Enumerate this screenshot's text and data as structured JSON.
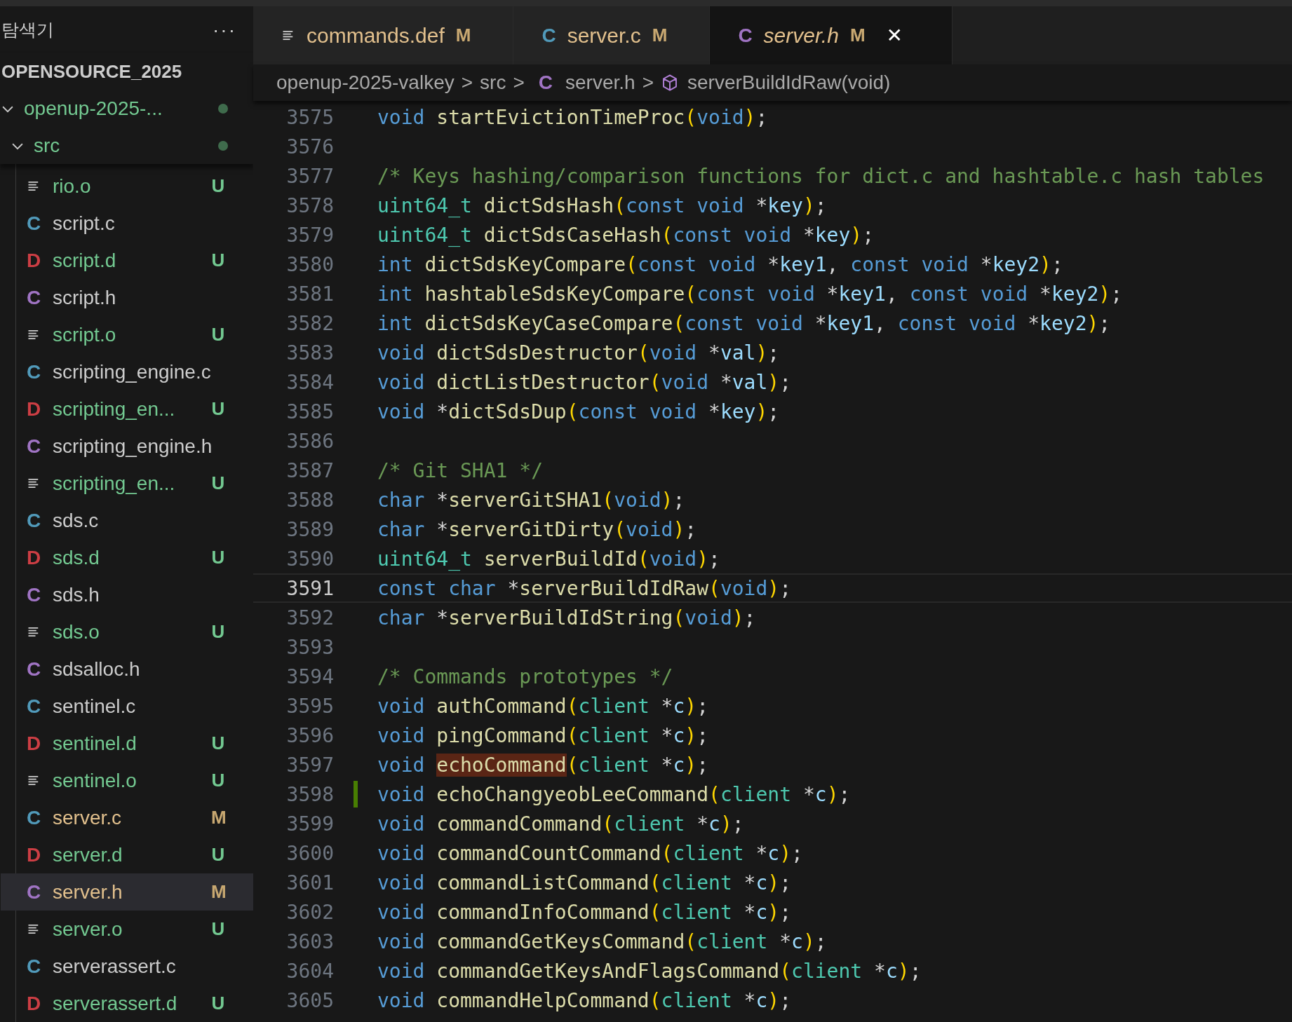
{
  "sidebar": {
    "title": "탐색기",
    "more": "···",
    "workspace": "OPENSOURCE_2025",
    "folders": [
      {
        "name": "openup-2025-...",
        "expanded": true
      },
      {
        "name": "src",
        "expanded": true
      }
    ],
    "files": [
      {
        "kind": "o",
        "name": "rio.o",
        "untracked": true,
        "status": "U",
        "selected": false
      },
      {
        "kind": "c",
        "badge": "C",
        "name": "script.c",
        "untracked": false,
        "modified": false,
        "selected": false
      },
      {
        "kind": "d",
        "badge": "D",
        "name": "script.d",
        "untracked": true,
        "status": "U",
        "selected": false
      },
      {
        "kind": "h",
        "badge": "C",
        "name": "script.h",
        "untracked": false,
        "modified": false,
        "selected": false
      },
      {
        "kind": "o",
        "name": "script.o",
        "untracked": true,
        "status": "U",
        "selected": false
      },
      {
        "kind": "c",
        "badge": "C",
        "name": "scripting_engine.c",
        "untracked": false,
        "modified": false,
        "selected": false
      },
      {
        "kind": "d",
        "badge": "D",
        "name": "scripting_en...",
        "untracked": true,
        "status": "U",
        "selected": false
      },
      {
        "kind": "h",
        "badge": "C",
        "name": "scripting_engine.h",
        "untracked": false,
        "modified": false,
        "selected": false
      },
      {
        "kind": "o",
        "name": "scripting_en...",
        "untracked": true,
        "status": "U",
        "selected": false
      },
      {
        "kind": "c",
        "badge": "C",
        "name": "sds.c",
        "untracked": false,
        "modified": false,
        "selected": false
      },
      {
        "kind": "d",
        "badge": "D",
        "name": "sds.d",
        "untracked": true,
        "status": "U",
        "selected": false
      },
      {
        "kind": "h",
        "badge": "C",
        "name": "sds.h",
        "untracked": false,
        "modified": false,
        "selected": false
      },
      {
        "kind": "o",
        "name": "sds.o",
        "untracked": true,
        "status": "U",
        "selected": false
      },
      {
        "kind": "h",
        "badge": "C",
        "name": "sdsalloc.h",
        "untracked": false,
        "modified": false,
        "selected": false
      },
      {
        "kind": "c",
        "badge": "C",
        "name": "sentinel.c",
        "untracked": false,
        "modified": false,
        "selected": false
      },
      {
        "kind": "d",
        "badge": "D",
        "name": "sentinel.d",
        "untracked": true,
        "status": "U",
        "selected": false
      },
      {
        "kind": "o",
        "name": "sentinel.o",
        "untracked": true,
        "status": "U",
        "selected": false
      },
      {
        "kind": "c",
        "badge": "C",
        "name": "server.c",
        "untracked": false,
        "modified": true,
        "status": "M",
        "selected": false
      },
      {
        "kind": "d",
        "badge": "D",
        "name": "server.d",
        "untracked": true,
        "status": "U",
        "selected": false
      },
      {
        "kind": "h",
        "badge": "C",
        "name": "server.h",
        "untracked": false,
        "modified": true,
        "status": "M",
        "selected": true
      },
      {
        "kind": "o",
        "name": "server.o",
        "untracked": true,
        "status": "U",
        "selected": false
      },
      {
        "kind": "c",
        "badge": "C",
        "name": "serverassert.c",
        "untracked": false,
        "modified": false,
        "selected": false
      },
      {
        "kind": "d",
        "badge": "D",
        "name": "serverassert.d",
        "untracked": true,
        "status": "U",
        "selected": false
      }
    ]
  },
  "tabs": [
    {
      "kind": "o",
      "label": "commands.def",
      "status": "M",
      "selected": false,
      "preview": false
    },
    {
      "kind": "c",
      "badge": "C",
      "label": "server.c",
      "status": "M",
      "selected": false,
      "preview": false
    },
    {
      "kind": "h",
      "badge": "C",
      "label": "server.h",
      "status": "M",
      "selected": true,
      "preview": true,
      "close": "✕"
    }
  ],
  "breadcrumb": [
    {
      "kind": "folder",
      "text": "openup-2025-valkey"
    },
    {
      "kind": "folder",
      "text": "src"
    },
    {
      "kind": "h",
      "badge": "C",
      "text": "server.h"
    },
    {
      "kind": "symbol",
      "text": "serverBuildIdRaw(void)"
    }
  ],
  "breadcrumb_separator": ">",
  "code": [
    {
      "number": "3575",
      "tokens": [
        {
          "kind": "kw",
          "text": "void "
        },
        {
          "kind": "fn",
          "text": "startEvictionTimeProc"
        },
        {
          "kind": "paren",
          "text": "("
        },
        {
          "kind": "kw",
          "text": "void"
        },
        {
          "kind": "paren",
          "text": ")"
        },
        {
          "kind": "punct",
          "text": ";"
        }
      ]
    },
    {
      "number": "3576"
    },
    {
      "number": "3577",
      "tokens": [
        {
          "kind": "comment",
          "text": "/* Keys hashing/comparison functions for dict.c and hashtable.c hash tables"
        }
      ]
    },
    {
      "number": "3578",
      "tokens": [
        {
          "kind": "type",
          "text": "uint64_t "
        },
        {
          "kind": "fn",
          "text": "dictSdsHash"
        },
        {
          "kind": "paren",
          "text": "("
        },
        {
          "kind": "kw",
          "text": "const void "
        },
        {
          "kind": "punct",
          "text": "*"
        },
        {
          "kind": "param",
          "text": "key"
        },
        {
          "kind": "paren",
          "text": ")"
        },
        {
          "kind": "punct",
          "text": ";"
        }
      ]
    },
    {
      "number": "3579",
      "tokens": [
        {
          "kind": "type",
          "text": "uint64_t "
        },
        {
          "kind": "fn",
          "text": "dictSdsCaseHash"
        },
        {
          "kind": "paren",
          "text": "("
        },
        {
          "kind": "kw",
          "text": "const void "
        },
        {
          "kind": "punct",
          "text": "*"
        },
        {
          "kind": "param",
          "text": "key"
        },
        {
          "kind": "paren",
          "text": ")"
        },
        {
          "kind": "punct",
          "text": ";"
        }
      ]
    },
    {
      "number": "3580",
      "tokens": [
        {
          "kind": "kw",
          "text": "int "
        },
        {
          "kind": "fn",
          "text": "dictSdsKeyCompare"
        },
        {
          "kind": "paren",
          "text": "("
        },
        {
          "kind": "kw",
          "text": "const void "
        },
        {
          "kind": "punct",
          "text": "*"
        },
        {
          "kind": "param",
          "text": "key1"
        },
        {
          "kind": "punct",
          "text": ", "
        },
        {
          "kind": "kw",
          "text": "const void "
        },
        {
          "kind": "punct",
          "text": "*"
        },
        {
          "kind": "param",
          "text": "key2"
        },
        {
          "kind": "paren",
          "text": ")"
        },
        {
          "kind": "punct",
          "text": ";"
        }
      ]
    },
    {
      "number": "3581",
      "tokens": [
        {
          "kind": "kw",
          "text": "int "
        },
        {
          "kind": "fn",
          "text": "hashtableSdsKeyCompare"
        },
        {
          "kind": "paren",
          "text": "("
        },
        {
          "kind": "kw",
          "text": "const void "
        },
        {
          "kind": "punct",
          "text": "*"
        },
        {
          "kind": "param",
          "text": "key1"
        },
        {
          "kind": "punct",
          "text": ", "
        },
        {
          "kind": "kw",
          "text": "const void "
        },
        {
          "kind": "punct",
          "text": "*"
        },
        {
          "kind": "param",
          "text": "key2"
        },
        {
          "kind": "paren",
          "text": ")"
        },
        {
          "kind": "punct",
          "text": ";"
        }
      ]
    },
    {
      "number": "3582",
      "tokens": [
        {
          "kind": "kw",
          "text": "int "
        },
        {
          "kind": "fn",
          "text": "dictSdsKeyCaseCompare"
        },
        {
          "kind": "paren",
          "text": "("
        },
        {
          "kind": "kw",
          "text": "const void "
        },
        {
          "kind": "punct",
          "text": "*"
        },
        {
          "kind": "param",
          "text": "key1"
        },
        {
          "kind": "punct",
          "text": ", "
        },
        {
          "kind": "kw",
          "text": "const void "
        },
        {
          "kind": "punct",
          "text": "*"
        },
        {
          "kind": "param",
          "text": "key2"
        },
        {
          "kind": "paren",
          "text": ")"
        },
        {
          "kind": "punct",
          "text": ";"
        }
      ]
    },
    {
      "number": "3583",
      "tokens": [
        {
          "kind": "kw",
          "text": "void "
        },
        {
          "kind": "fn",
          "text": "dictSdsDestructor"
        },
        {
          "kind": "paren",
          "text": "("
        },
        {
          "kind": "kw",
          "text": "void "
        },
        {
          "kind": "punct",
          "text": "*"
        },
        {
          "kind": "param",
          "text": "val"
        },
        {
          "kind": "paren",
          "text": ")"
        },
        {
          "kind": "punct",
          "text": ";"
        }
      ]
    },
    {
      "number": "3584",
      "tokens": [
        {
          "kind": "kw",
          "text": "void "
        },
        {
          "kind": "fn",
          "text": "dictListDestructor"
        },
        {
          "kind": "paren",
          "text": "("
        },
        {
          "kind": "kw",
          "text": "void "
        },
        {
          "kind": "punct",
          "text": "*"
        },
        {
          "kind": "param",
          "text": "val"
        },
        {
          "kind": "paren",
          "text": ")"
        },
        {
          "kind": "punct",
          "text": ";"
        }
      ]
    },
    {
      "number": "3585",
      "tokens": [
        {
          "kind": "kw",
          "text": "void "
        },
        {
          "kind": "punct",
          "text": "*"
        },
        {
          "kind": "fn",
          "text": "dictSdsDup"
        },
        {
          "kind": "paren",
          "text": "("
        },
        {
          "kind": "kw",
          "text": "const void "
        },
        {
          "kind": "punct",
          "text": "*"
        },
        {
          "kind": "param",
          "text": "key"
        },
        {
          "kind": "paren",
          "text": ")"
        },
        {
          "kind": "punct",
          "text": ";"
        }
      ]
    },
    {
      "number": "3586"
    },
    {
      "number": "3587",
      "tokens": [
        {
          "kind": "comment",
          "text": "/* Git SHA1 */"
        }
      ]
    },
    {
      "number": "3588",
      "tokens": [
        {
          "kind": "kw",
          "text": "char "
        },
        {
          "kind": "punct",
          "text": "*"
        },
        {
          "kind": "fn",
          "text": "serverGitSHA1"
        },
        {
          "kind": "paren",
          "text": "("
        },
        {
          "kind": "kw",
          "text": "void"
        },
        {
          "kind": "paren",
          "text": ")"
        },
        {
          "kind": "punct",
          "text": ";"
        }
      ]
    },
    {
      "number": "3589",
      "tokens": [
        {
          "kind": "kw",
          "text": "char "
        },
        {
          "kind": "punct",
          "text": "*"
        },
        {
          "kind": "fn",
          "text": "serverGitDirty"
        },
        {
          "kind": "paren",
          "text": "("
        },
        {
          "kind": "kw",
          "text": "void"
        },
        {
          "kind": "paren",
          "text": ")"
        },
        {
          "kind": "punct",
          "text": ";"
        }
      ]
    },
    {
      "number": "3590",
      "tokens": [
        {
          "kind": "type",
          "text": "uint64_t "
        },
        {
          "kind": "fn",
          "text": "serverBuildId"
        },
        {
          "kind": "paren",
          "text": "("
        },
        {
          "kind": "kw",
          "text": "void"
        },
        {
          "kind": "paren",
          "text": ")"
        },
        {
          "kind": "punct",
          "text": ";"
        }
      ]
    },
    {
      "number": "3591",
      "current": true,
      "tokens": [
        {
          "kind": "kw",
          "text": "const char "
        },
        {
          "kind": "punct",
          "text": "*"
        },
        {
          "kind": "fn",
          "text": "serverBuildIdRaw"
        },
        {
          "kind": "paren",
          "text": "("
        },
        {
          "kind": "kw",
          "text": "void"
        },
        {
          "kind": "paren",
          "text": ")"
        },
        {
          "kind": "punct",
          "text": ";"
        }
      ]
    },
    {
      "number": "3592",
      "tokens": [
        {
          "kind": "kw",
          "text": "char "
        },
        {
          "kind": "punct",
          "text": "*"
        },
        {
          "kind": "fn",
          "text": "serverBuildIdString"
        },
        {
          "kind": "paren",
          "text": "("
        },
        {
          "kind": "kw",
          "text": "void"
        },
        {
          "kind": "paren",
          "text": ")"
        },
        {
          "kind": "punct",
          "text": ";"
        }
      ]
    },
    {
      "number": "3593"
    },
    {
      "number": "3594",
      "tokens": [
        {
          "kind": "comment",
          "text": "/* Commands prototypes */"
        }
      ]
    },
    {
      "number": "3595",
      "tokens": [
        {
          "kind": "kw",
          "text": "void "
        },
        {
          "kind": "fn",
          "text": "authCommand"
        },
        {
          "kind": "paren",
          "text": "("
        },
        {
          "kind": "type",
          "text": "client "
        },
        {
          "kind": "punct",
          "text": "*"
        },
        {
          "kind": "param",
          "text": "c"
        },
        {
          "kind": "paren",
          "text": ")"
        },
        {
          "kind": "punct",
          "text": ";"
        }
      ]
    },
    {
      "number": "3596",
      "tokens": [
        {
          "kind": "kw",
          "text": "void "
        },
        {
          "kind": "fn",
          "text": "pingCommand"
        },
        {
          "kind": "paren",
          "text": "("
        },
        {
          "kind": "type",
          "text": "client "
        },
        {
          "kind": "punct",
          "text": "*"
        },
        {
          "kind": "param",
          "text": "c"
        },
        {
          "kind": "paren",
          "text": ")"
        },
        {
          "kind": "punct",
          "text": ";"
        }
      ]
    },
    {
      "number": "3597",
      "tokens": [
        {
          "kind": "kw",
          "text": "void "
        },
        {
          "kind": "fn",
          "text": "echoCommand",
          "highlight": true
        },
        {
          "kind": "paren",
          "text": "("
        },
        {
          "kind": "type",
          "text": "client "
        },
        {
          "kind": "punct",
          "text": "*"
        },
        {
          "kind": "param",
          "text": "c"
        },
        {
          "kind": "paren",
          "text": ")"
        },
        {
          "kind": "punct",
          "text": ";"
        }
      ]
    },
    {
      "number": "3598",
      "changed": true,
      "tokens": [
        {
          "kind": "kw",
          "text": "void "
        },
        {
          "kind": "fn",
          "text": "echoChangyeobLeeCommand"
        },
        {
          "kind": "paren",
          "text": "("
        },
        {
          "kind": "type",
          "text": "client "
        },
        {
          "kind": "punct",
          "text": "*"
        },
        {
          "kind": "param",
          "text": "c"
        },
        {
          "kind": "paren",
          "text": ")"
        },
        {
          "kind": "punct",
          "text": ";"
        }
      ]
    },
    {
      "number": "3599",
      "tokens": [
        {
          "kind": "kw",
          "text": "void "
        },
        {
          "kind": "fn",
          "text": "commandCommand"
        },
        {
          "kind": "paren",
          "text": "("
        },
        {
          "kind": "type",
          "text": "client "
        },
        {
          "kind": "punct",
          "text": "*"
        },
        {
          "kind": "param",
          "text": "c"
        },
        {
          "kind": "paren",
          "text": ")"
        },
        {
          "kind": "punct",
          "text": ";"
        }
      ]
    },
    {
      "number": "3600",
      "tokens": [
        {
          "kind": "kw",
          "text": "void "
        },
        {
          "kind": "fn",
          "text": "commandCountCommand"
        },
        {
          "kind": "paren",
          "text": "("
        },
        {
          "kind": "type",
          "text": "client "
        },
        {
          "kind": "punct",
          "text": "*"
        },
        {
          "kind": "param",
          "text": "c"
        },
        {
          "kind": "paren",
          "text": ")"
        },
        {
          "kind": "punct",
          "text": ";"
        }
      ]
    },
    {
      "number": "3601",
      "tokens": [
        {
          "kind": "kw",
          "text": "void "
        },
        {
          "kind": "fn",
          "text": "commandListCommand"
        },
        {
          "kind": "paren",
          "text": "("
        },
        {
          "kind": "type",
          "text": "client "
        },
        {
          "kind": "punct",
          "text": "*"
        },
        {
          "kind": "param",
          "text": "c"
        },
        {
          "kind": "paren",
          "text": ")"
        },
        {
          "kind": "punct",
          "text": ";"
        }
      ]
    },
    {
      "number": "3602",
      "tokens": [
        {
          "kind": "kw",
          "text": "void "
        },
        {
          "kind": "fn",
          "text": "commandInfoCommand"
        },
        {
          "kind": "paren",
          "text": "("
        },
        {
          "kind": "type",
          "text": "client "
        },
        {
          "kind": "punct",
          "text": "*"
        },
        {
          "kind": "param",
          "text": "c"
        },
        {
          "kind": "paren",
          "text": ")"
        },
        {
          "kind": "punct",
          "text": ";"
        }
      ]
    },
    {
      "number": "3603",
      "tokens": [
        {
          "kind": "kw",
          "text": "void "
        },
        {
          "kind": "fn",
          "text": "commandGetKeysCommand"
        },
        {
          "kind": "paren",
          "text": "("
        },
        {
          "kind": "type",
          "text": "client "
        },
        {
          "kind": "punct",
          "text": "*"
        },
        {
          "kind": "param",
          "text": "c"
        },
        {
          "kind": "paren",
          "text": ")"
        },
        {
          "kind": "punct",
          "text": ";"
        }
      ]
    },
    {
      "number": "3604",
      "tokens": [
        {
          "kind": "kw",
          "text": "void "
        },
        {
          "kind": "fn",
          "text": "commandGetKeysAndFlagsCommand"
        },
        {
          "kind": "paren",
          "text": "("
        },
        {
          "kind": "type",
          "text": "client "
        },
        {
          "kind": "punct",
          "text": "*"
        },
        {
          "kind": "param",
          "text": "c"
        },
        {
          "kind": "paren",
          "text": ")"
        },
        {
          "kind": "punct",
          "text": ";"
        }
      ]
    },
    {
      "number": "3605",
      "tokens": [
        {
          "kind": "kw",
          "text": "void "
        },
        {
          "kind": "fn",
          "text": "commandHelpCommand"
        },
        {
          "kind": "paren",
          "text": "("
        },
        {
          "kind": "type",
          "text": "client "
        },
        {
          "kind": "punct",
          "text": "*"
        },
        {
          "kind": "param",
          "text": "c"
        },
        {
          "kind": "paren",
          "text": ")"
        },
        {
          "kind": "punct",
          "text": ";"
        }
      ]
    }
  ]
}
